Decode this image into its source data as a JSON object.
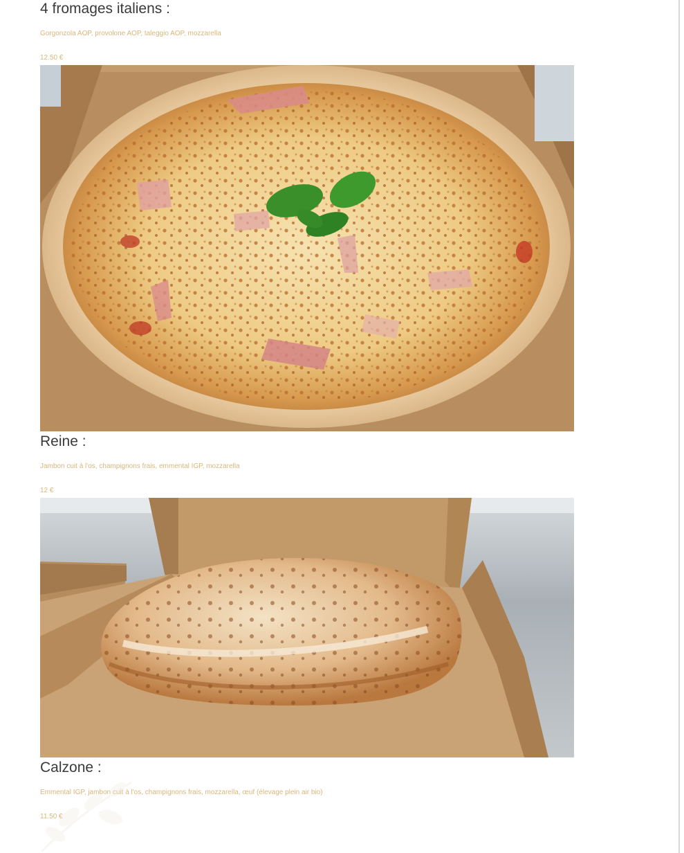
{
  "menu": {
    "items": [
      {
        "title": "4 fromages italiens :",
        "description": "Gorgonzola AOP, provolone AOP, taleggio AOP, mozzarella",
        "price": "12.50 €"
      },
      {
        "title": "Reine :",
        "description": "Jambon cuit à l'os, champignons frais, emmental IGP, mozzarella",
        "price": "12 €"
      },
      {
        "title": "Calzone :",
        "description": "Emmental IGP, jambon cuit à l'os, champignons frais, mozzarella, œuf (élevage plein air bio)",
        "price": "11.50 €"
      }
    ]
  },
  "colors": {
    "title": "#3a3a3a",
    "accent_text": "#d8b77a",
    "background": "#ffffff"
  },
  "images": {
    "pizza_photo_icon": "pizza-photo",
    "calzone_photo_icon": "calzone-photo",
    "watermark_icon": "leaf-watermark-icon"
  }
}
